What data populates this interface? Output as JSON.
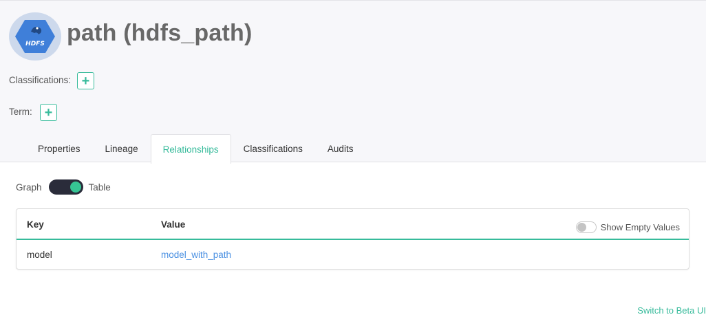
{
  "entity": {
    "title": "path (hdfs_path)",
    "icon": "hdfs-icon",
    "icon_text": "HDFS"
  },
  "classifications": {
    "label": "Classifications:",
    "add_icon": "+"
  },
  "term": {
    "label": "Term:",
    "add_icon": "+"
  },
  "tabs": [
    {
      "label": "Properties",
      "active": false
    },
    {
      "label": "Lineage",
      "active": false
    },
    {
      "label": "Relationships",
      "active": true
    },
    {
      "label": "Classifications",
      "active": false
    },
    {
      "label": "Audits",
      "active": false
    }
  ],
  "view_toggle": {
    "left_label": "Graph",
    "right_label": "Table",
    "selected": "Table"
  },
  "table": {
    "headers": {
      "key": "Key",
      "value": "Value"
    },
    "show_empty_label": "Show Empty Values",
    "show_empty_enabled": false,
    "rows": [
      {
        "key": "model",
        "value": "model_with_path"
      }
    ]
  },
  "footer": {
    "beta_link": "Switch to Beta UI"
  },
  "colors": {
    "accent": "#37bb9b",
    "link": "#4a90e2",
    "toggle_dark": "#2a2c3a"
  }
}
